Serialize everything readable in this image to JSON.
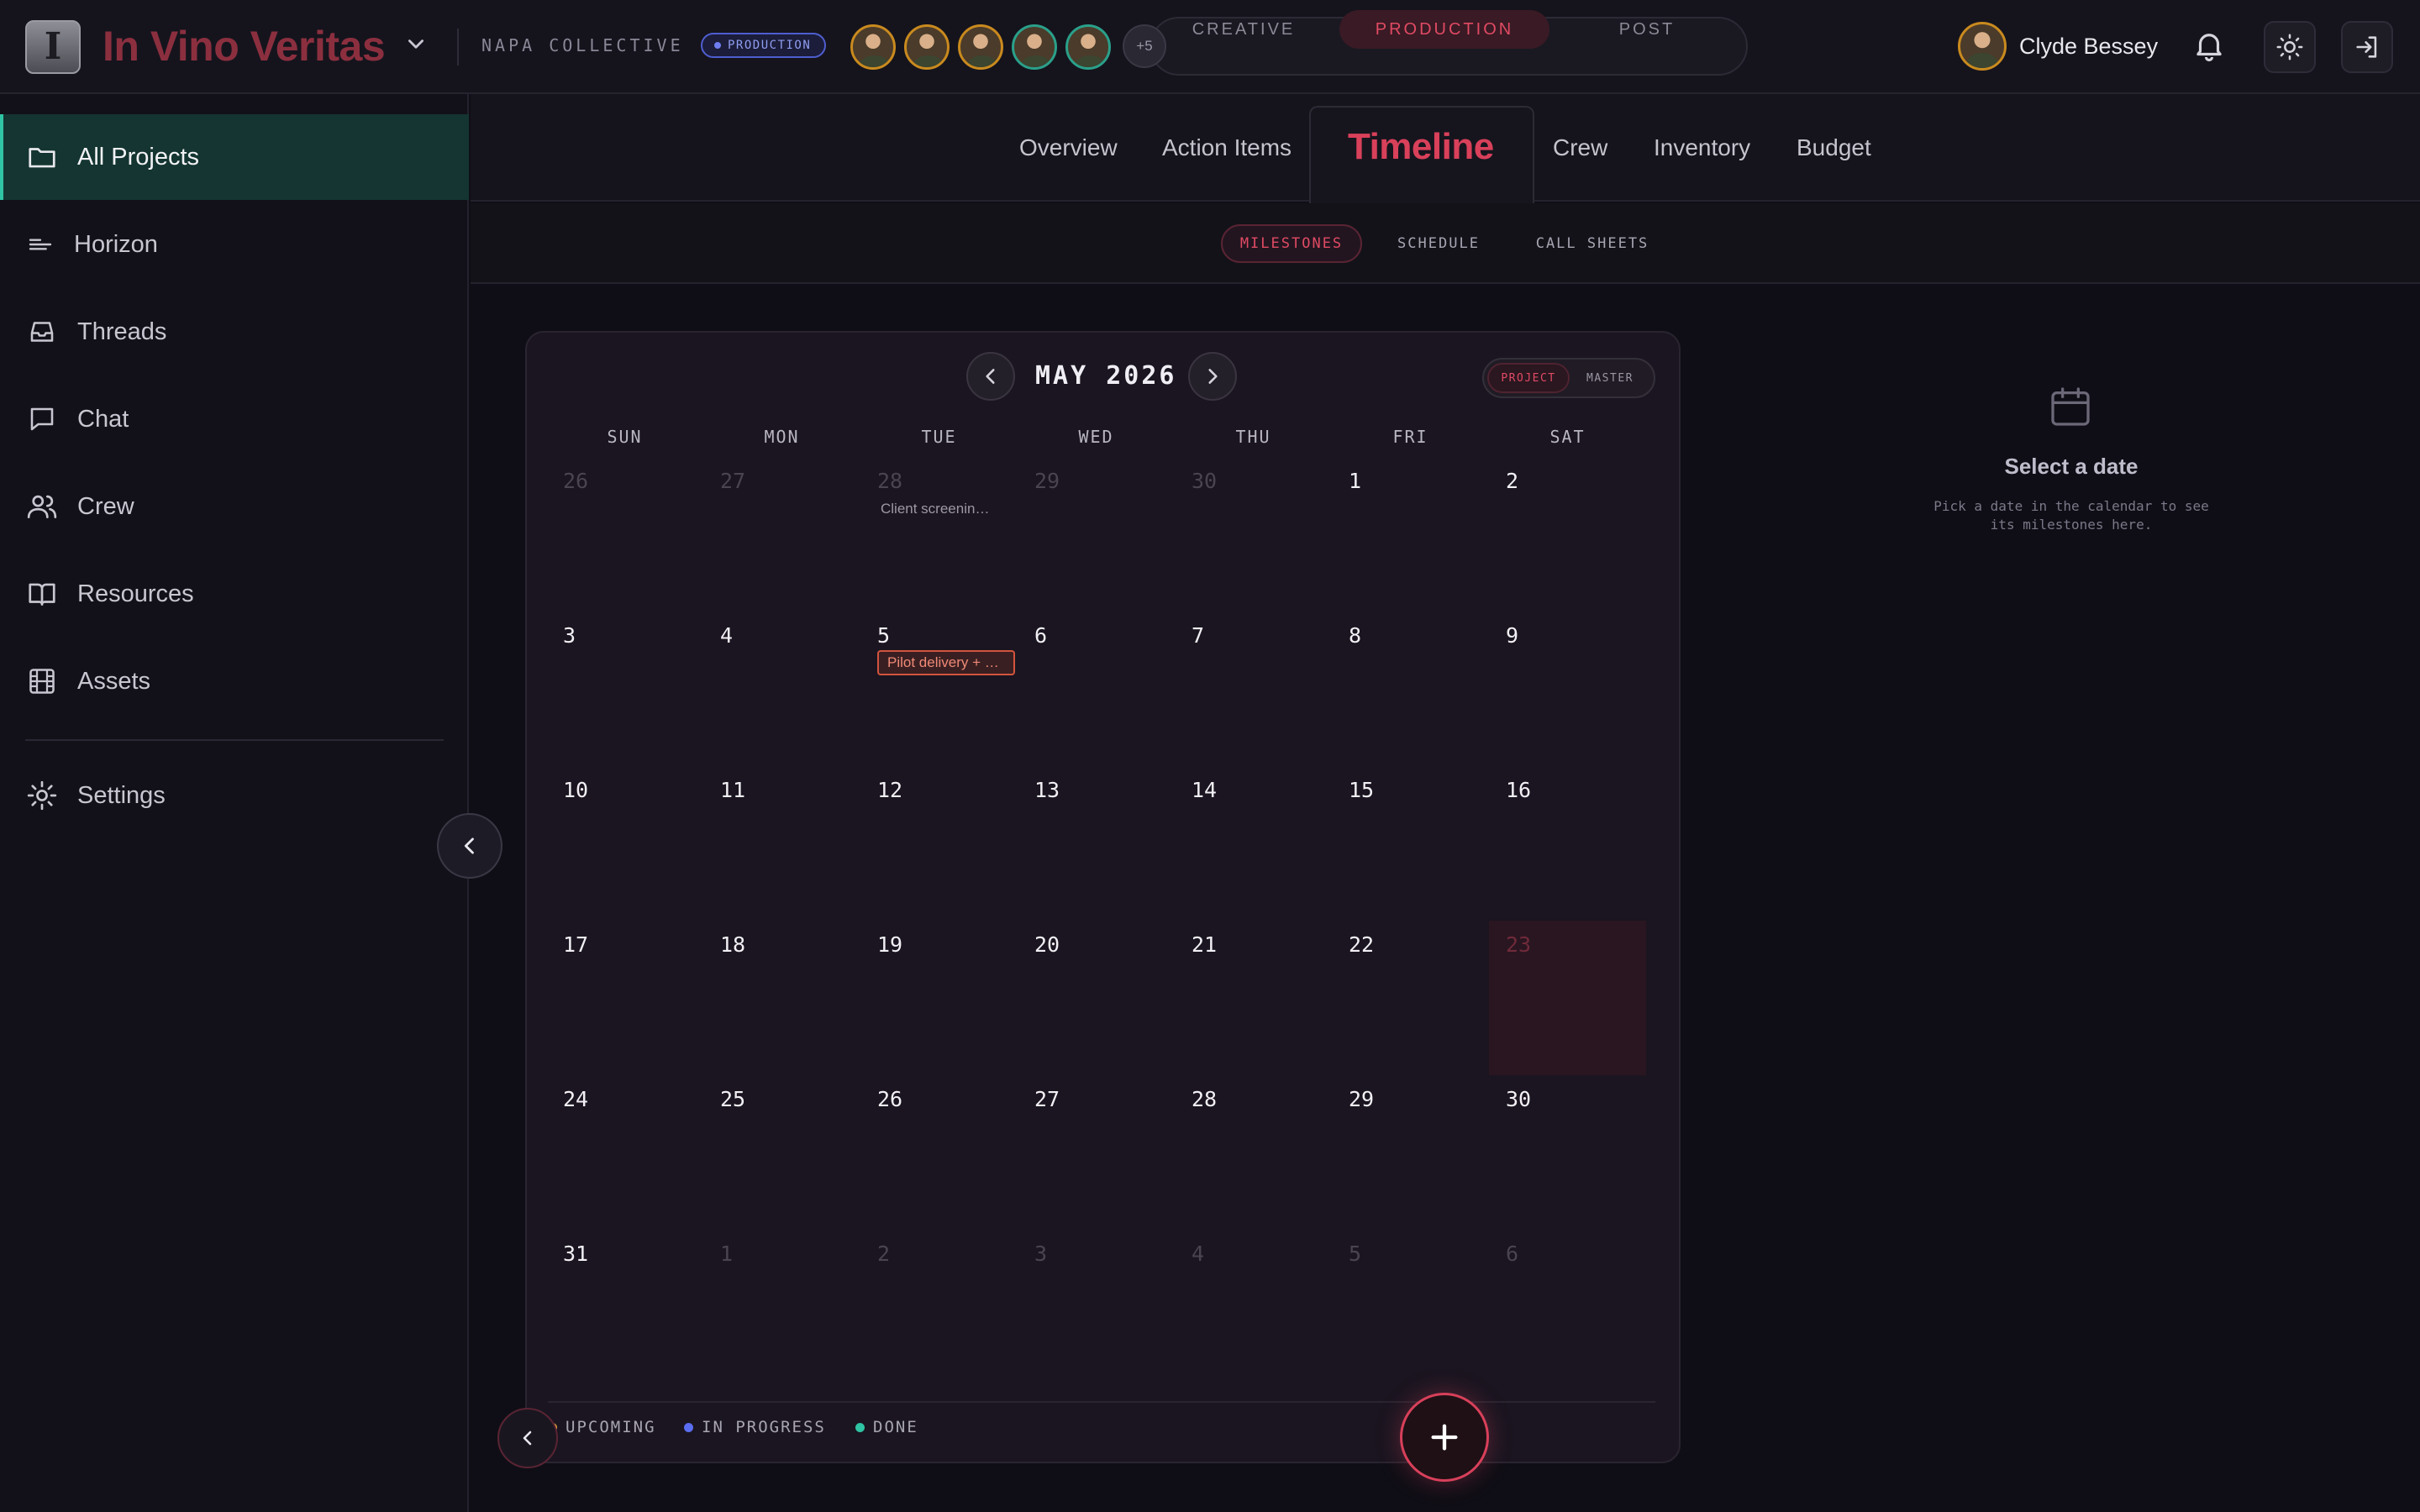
{
  "header": {
    "project_title": "In Vino Veritas",
    "client": "NAPA COLLECTIVE",
    "status": "PRODUCTION",
    "more_avatars": "+5",
    "phases": [
      "CREATIVE",
      "PRODUCTION",
      "POST"
    ],
    "active_phase": "PRODUCTION",
    "user_name": "Clyde Bessey"
  },
  "sidebar": {
    "items": [
      {
        "label": "All Projects",
        "icon": "folder-icon",
        "active": true
      },
      {
        "label": "Horizon",
        "icon": "horizon-icon"
      },
      {
        "label": "Threads",
        "icon": "inbox-icon"
      },
      {
        "label": "Chat",
        "icon": "chat-icon"
      },
      {
        "label": "Crew",
        "icon": "users-icon"
      },
      {
        "label": "Resources",
        "icon": "book-icon"
      },
      {
        "label": "Assets",
        "icon": "film-icon"
      }
    ],
    "settings": {
      "label": "Settings",
      "icon": "gear-icon"
    }
  },
  "tabs": [
    "Overview",
    "Action Items",
    "Timeline",
    "Crew",
    "Inventory",
    "Budget"
  ],
  "active_tab": "Timeline",
  "subtabs": [
    "MILESTONES",
    "SCHEDULE",
    "CALL SHEETS"
  ],
  "calendar": {
    "month_label": "MAY 2026",
    "scope": [
      "PROJECT",
      "MASTER"
    ],
    "weekdays": [
      "SUN",
      "MON",
      "TUE",
      "WED",
      "THU",
      "FRI",
      "SAT"
    ],
    "days": [
      {
        "d": "26",
        "out": true
      },
      {
        "d": "27",
        "out": true
      },
      {
        "d": "28",
        "out": true,
        "event": "Client screenin…"
      },
      {
        "d": "29",
        "out": true
      },
      {
        "d": "30",
        "out": true
      },
      {
        "d": "1"
      },
      {
        "d": "2"
      },
      {
        "d": "3"
      },
      {
        "d": "4"
      },
      {
        "d": "5",
        "tag": "Pilot delivery + …"
      },
      {
        "d": "6"
      },
      {
        "d": "7"
      },
      {
        "d": "8"
      },
      {
        "d": "9"
      },
      {
        "d": "10"
      },
      {
        "d": "11"
      },
      {
        "d": "12"
      },
      {
        "d": "13"
      },
      {
        "d": "14"
      },
      {
        "d": "15"
      },
      {
        "d": "16"
      },
      {
        "d": "17"
      },
      {
        "d": "18"
      },
      {
        "d": "19"
      },
      {
        "d": "20"
      },
      {
        "d": "21"
      },
      {
        "d": "22"
      },
      {
        "d": "23",
        "today": true
      },
      {
        "d": "24"
      },
      {
        "d": "25"
      },
      {
        "d": "26"
      },
      {
        "d": "27"
      },
      {
        "d": "28"
      },
      {
        "d": "29"
      },
      {
        "d": "30"
      },
      {
        "d": "31"
      },
      {
        "d": "1",
        "out": true
      },
      {
        "d": "2",
        "out": true
      },
      {
        "d": "3",
        "out": true
      },
      {
        "d": "4",
        "out": true
      },
      {
        "d": "5",
        "out": true
      },
      {
        "d": "6",
        "out": true
      }
    ],
    "legend": [
      {
        "label": "UPCOMING",
        "color": "#e0a23a"
      },
      {
        "label": "IN PROGRESS",
        "color": "#5b6df0"
      },
      {
        "label": "DONE",
        "color": "#2fc4a4"
      }
    ]
  },
  "detail": {
    "title": "Select a date",
    "description": "Pick a date in the calendar to see its milestones here."
  },
  "colors": {
    "accent": "#d9405a",
    "teal": "#2fc4a4",
    "bg": "#0f0e16"
  }
}
